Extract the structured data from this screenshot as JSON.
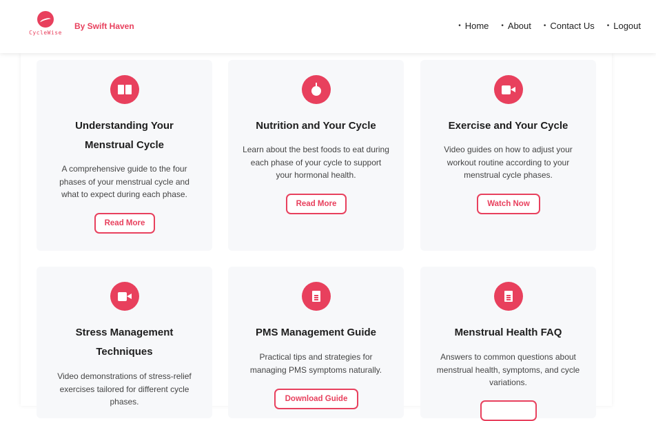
{
  "header": {
    "logo_text": "CycleWise",
    "brand": "By Swift Haven",
    "nav": [
      "Home",
      "About",
      "Contact Us",
      "Logout"
    ]
  },
  "cards": [
    {
      "icon": "book-icon",
      "title": "Understanding Your Menstrual Cycle",
      "description": "A comprehensive guide to the four phases of your menstrual cycle and what to expect during each phase.",
      "button": "Read More"
    },
    {
      "icon": "apple-icon",
      "title": "Nutrition and Your Cycle",
      "description": "Learn about the best foods to eat during each phase of your cycle to support your hormonal health.",
      "button": "Read More"
    },
    {
      "icon": "video-icon",
      "title": "Exercise and Your Cycle",
      "description": "Video guides on how to adjust your workout routine according to your menstrual cycle phases.",
      "button": "Watch Now"
    },
    {
      "icon": "video-icon",
      "title": "Stress Management Techniques",
      "description": "Video demonstrations of stress-relief exercises tailored for different cycle phases.",
      "button": ""
    },
    {
      "icon": "document-icon",
      "title": "PMS Management Guide",
      "description": "Practical tips and strategies for managing PMS symptoms naturally.",
      "button": "Download Guide"
    },
    {
      "icon": "document-icon",
      "title": "Menstrual Health FAQ",
      "description": "Answers to common questions about menstrual health, symptoms, and cycle variations.",
      "button": ""
    }
  ],
  "colors": {
    "accent": "#e8405d",
    "card_bg": "#f7f8fa"
  }
}
